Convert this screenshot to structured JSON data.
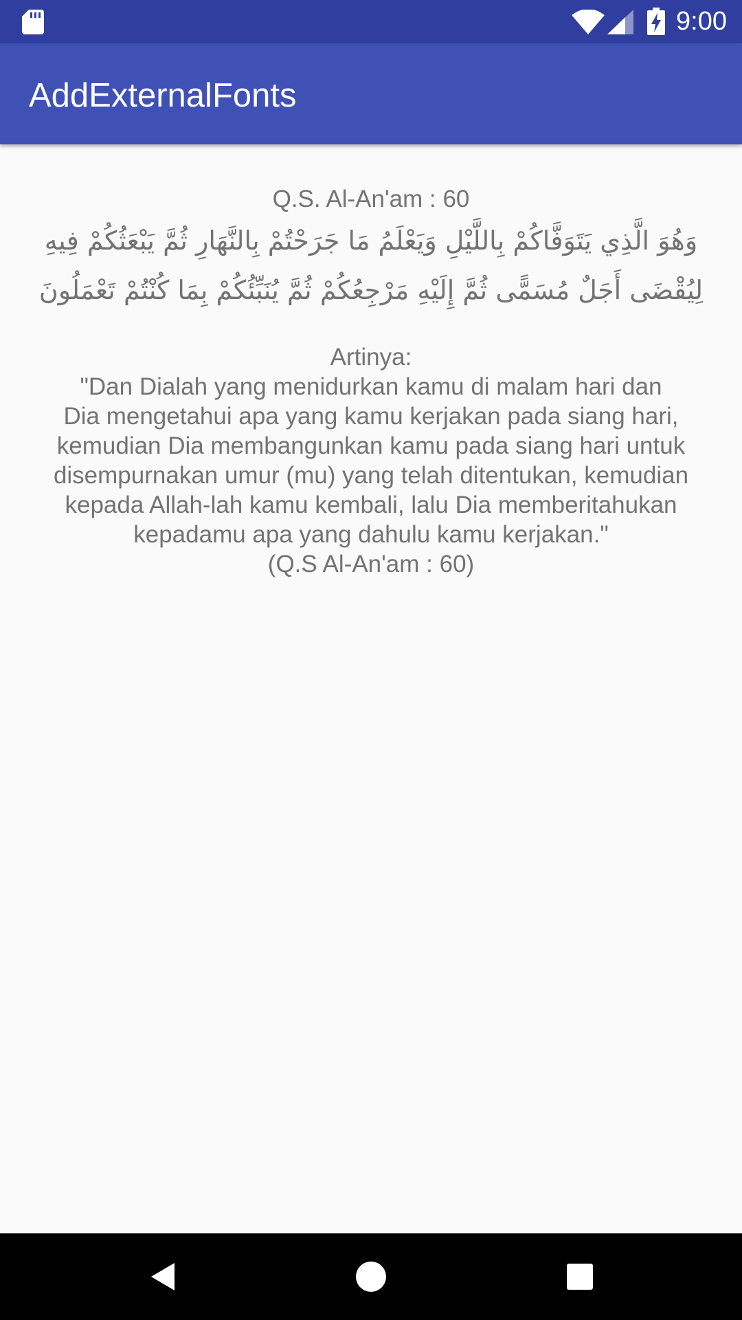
{
  "status_bar": {
    "time": "9:00",
    "icons": [
      "sd-card-icon",
      "wifi-icon",
      "signal-icon",
      "battery-charging-icon"
    ]
  },
  "app_bar": {
    "title": "AddExternalFonts",
    "color": "#3f51b5",
    "status_color": "#303f9f"
  },
  "content": {
    "surah_reference": "Q.S. Al-An'am : 60",
    "arabic_lines": [
      "وَهُوَ الَّذِي يَتَوَفَّاكُمْ بِاللَّيْلِ وَيَعْلَمُ مَا جَرَحْتُمْ بِالنَّهَارِ ثُمَّ يَبْعَثُكُمْ فِيهِ",
      "لِيُقْضَى أَجَلٌ مُسَمًّى ثُمَّ إِلَيْهِ مَرْجِعُكُمْ ثُمَّ يُنَبِّئُكُمْ بِمَا كُنْتُمْ تَعْمَلُونَ"
    ],
    "translation_lines": [
      "Artinya:",
      "\"Dan Dialah yang menidurkan kamu di malam hari dan",
      "Dia mengetahui apa yang kamu kerjakan pada siang hari,",
      "kemudian Dia membangunkan kamu pada siang hari untuk",
      "disempurnakan umur (mu) yang telah ditentukan, kemudian",
      "kepada Allah-lah kamu kembali, lalu Dia memberitahukan",
      "kepadamu apa yang dahulu kamu kerjakan.\"",
      "(Q.S Al-An'am : 60)"
    ],
    "text_color": "#737373"
  },
  "nav_bar": {
    "buttons": [
      "back-icon",
      "home-icon",
      "recents-icon"
    ]
  }
}
